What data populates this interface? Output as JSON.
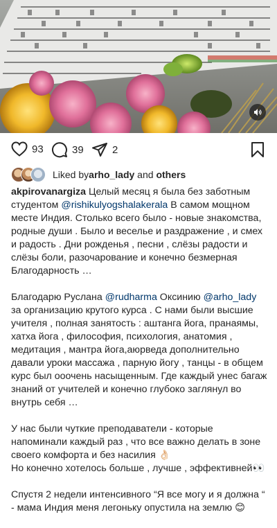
{
  "post": {
    "like_count": "93",
    "comment_count": "39",
    "share_count": "2",
    "icons": {
      "like": "heart-icon",
      "comment": "comment-icon",
      "share": "send-icon",
      "save": "bookmark-icon",
      "mute": "speaker-icon"
    }
  },
  "liked_by": {
    "prefix": "Liked by ",
    "user": "arho_lady",
    "middle": " and ",
    "suffix": "others"
  },
  "caption": {
    "author": "akpirovanargiza",
    "p1_a": " Целый месяц я была без заботным студентом ",
    "p1_mention": "@rishikulyogshalakerala",
    "p1_b": " В самом мощном месте Индия.  Столько всего было - новые знакомства, родные души . Было и веселье и раздражение , и смех и радость . Дни рожденья , песни , слёзы радости и слёзы боли, разочарование и конечно безмерная Благодарность …",
    "p2_a": "Благодарю Руслана ",
    "p2_mention1": "@rudharma",
    "p2_b": " Оксинию ",
    "p2_mention2": "@arho_lady",
    "p2_c": " за организацию крутого  курса . С нами были высшие учителя , полная занятость : аштанга йога, пранаямы, хатха йога , философия, психология, анатомия , медитация , мантра йога,аюрведа  дополнительно давали уроки массажа , парную йогу , танцы - в общем курс был ооочень насыщенным. Где каждый унес багаж знаний от учителей и конечно глубоко заглянул во внутрь себя …",
    "p3_a": "У нас были чуткие преподаватели - которые напоминали каждый раз , что все важно  делать в зоне своего комфорта и без насилия 👌🏻",
    "p3_b": "Но конечно хотелось больше , лучше , эффективней👀",
    "p4": "Спустя 2 недели интенсивного “Я все могу и я должна “ - мама Индия меня легоньку опустила на землю 😊"
  },
  "colors": {
    "text": "#262626",
    "mention": "#00376b"
  }
}
